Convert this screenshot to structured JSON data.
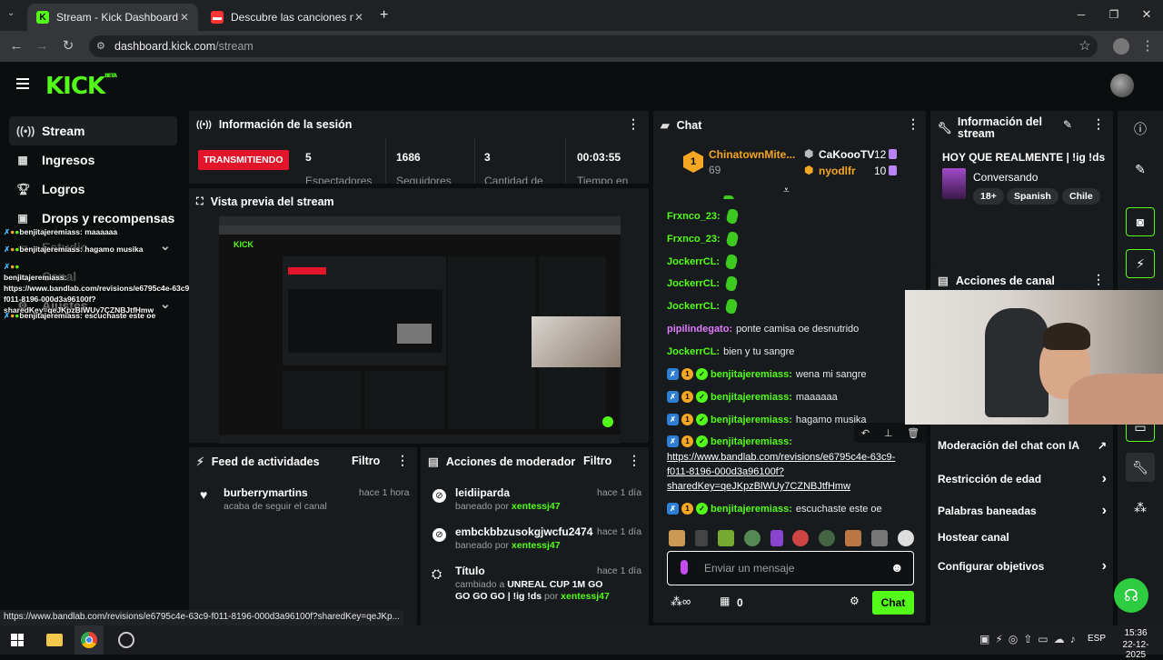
{
  "browser": {
    "tabs": [
      {
        "label": "Stream - Kick Dashboard",
        "active": true
      },
      {
        "label": "Descubre las canciones más es",
        "active": false
      }
    ],
    "url_host": "dashboard.kick.com",
    "url_path": "/stream"
  },
  "app": {
    "logo": "KICK",
    "logo_badge": "BETA"
  },
  "sidebar": {
    "items": [
      {
        "label": "Stream",
        "icon": "broadcast-icon",
        "active": true
      },
      {
        "label": "Ingresos",
        "icon": "chart-icon"
      },
      {
        "label": "Logros",
        "icon": "trophy-icon"
      },
      {
        "label": "Drops y recompensas",
        "icon": "gift-icon"
      },
      {
        "label": "Estudio",
        "icon": "studio-icon"
      },
      {
        "label": "Canal",
        "icon": "channel-icon"
      },
      {
        "label": "Ajustes",
        "icon": "settings-icon"
      }
    ],
    "overlay_chat": [
      "benjitajeremiass: maaaaaa",
      "benjitajeremiass: hagamo musika",
      "benjitajeremiass: https://www.bandlab.com/revisions/e6795c4e-63c9-f011-8196-000d3a96100f?sharedKey=qeJKpzBlWUy7CZNBJtfHmw",
      "benjitajeremiass: escuchaste este oe"
    ]
  },
  "session": {
    "title": "Información de la sesión",
    "status": "TRANSMITIENDO",
    "stats": [
      {
        "value": "5",
        "label": "Espectadores"
      },
      {
        "value": "1686",
        "label": "Seguidores"
      },
      {
        "value": "3",
        "label": "Cantidad de"
      },
      {
        "value": "00:03:55",
        "label": "Tiempo en"
      }
    ]
  },
  "preview": {
    "title": "Vista previa del stream"
  },
  "feed": {
    "title": "Feed de actividades",
    "filter": "Filtro",
    "items": [
      {
        "name": "burberrymartins",
        "sub": "acaba de seguir el canal",
        "time": "hace 1 hora"
      }
    ]
  },
  "modactions": {
    "title": "Acciones de moderador",
    "filter": "Filtro",
    "items": [
      {
        "name": "leidiiparda",
        "sub_prefix": "baneado por",
        "by": "xentessj47",
        "time": "hace 1 día"
      },
      {
        "name": "embckbbzusokgjwcfu2474",
        "sub_prefix": "baneado por",
        "by": "xentessj47",
        "time": "hace 1 día"
      },
      {
        "name": "Título",
        "sub_prefix": "cambiado a",
        "sub_bold": "UNREAL CUP 1M GO GO GO GO | !ig !ds",
        "sub_mid": "por",
        "by": "xentessj47",
        "time": "hace 1 día"
      }
    ]
  },
  "chat": {
    "title": "Chat",
    "leaders": [
      {
        "name": "ChinatownMite...",
        "value": "69",
        "rank": "1"
      },
      {
        "name": "CaKoooTV",
        "value": "12"
      },
      {
        "name": "nyodlfr",
        "value": "10"
      }
    ],
    "messages": [
      {
        "user": "Frxnco_23:",
        "text": "",
        "emote": true
      },
      {
        "user": "Frxnco_23:",
        "text": "",
        "emote": true
      },
      {
        "user": "JockerrCL:",
        "text": "",
        "emote": true
      },
      {
        "user": "JockerrCL:",
        "text": "",
        "emote": true
      },
      {
        "user": "JockerrCL:",
        "text": "",
        "emote": true
      },
      {
        "user": "pipilindegato:",
        "text": "ponte camisa oe desnutrido"
      },
      {
        "user": "JockerrCL:",
        "text": "bien y tu sangre"
      },
      {
        "user": "benjitajeremiass:",
        "text": "wena mi sangre"
      },
      {
        "user": "benjitajeremiass:",
        "text": "maaaaaa"
      },
      {
        "user": "benjitajeremiass:",
        "text": "hagamo musika"
      },
      {
        "user": "benjitajeremiass:",
        "text": ""
      },
      {
        "user": "benjitajeremiass:",
        "text": "escuchaste este oe"
      }
    ],
    "link_lines": [
      "https://www.bandlab.com/revisions/e6795c4e-63c9-",
      "f011-8196-000d3a96100f?",
      "sharedKey=qeJKpzBlWUy7CZNBJtfHmw"
    ],
    "input_placeholder": "Enviar un mensaje",
    "points": "0",
    "send_label": "Chat"
  },
  "streaminfo": {
    "title": "Información del stream",
    "stream_title": "HOY QUE REALMENTE | !ig !ds",
    "category": "Conversando",
    "tags": [
      "18+",
      "Spanish",
      "Chile"
    ]
  },
  "channel_actions": {
    "title": "Acciones de canal",
    "items": [
      {
        "label": "Moderación del chat con IA",
        "chevron": "↗"
      },
      {
        "label": "Restricción de edad",
        "chevron": "›"
      },
      {
        "label": "Palabras baneadas",
        "chevron": "›"
      },
      {
        "label": "Hostear canal",
        "chevron": ""
      },
      {
        "label": "Configurar objetivos",
        "chevron": "›"
      }
    ]
  },
  "statusbar": {
    "url": "https://www.bandlab.com/revisions/e6795c4e-63c9-f011-8196-000d3a96100f?sharedKey=qeJKp..."
  },
  "taskbar": {
    "lang": "ESP",
    "time": "15:36",
    "date": "22-12-2025"
  },
  "colors": {
    "kick_green": "#53fc18",
    "live_red": "#e3152b",
    "panel_bg": "#181b1d"
  }
}
